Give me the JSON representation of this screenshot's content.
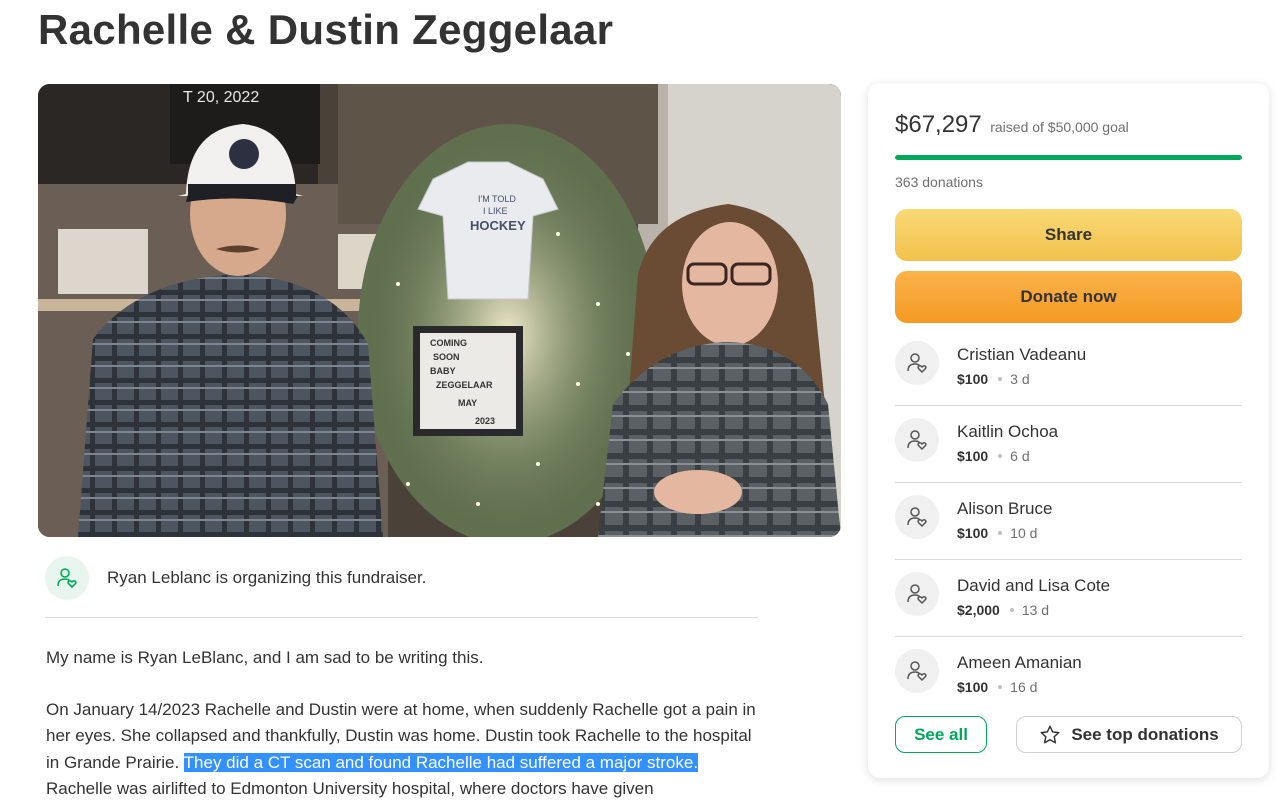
{
  "campaign": {
    "title": "Rachelle & Dustin Zeggelaar",
    "photo": {
      "sign_lines": [
        "COMING",
        "SOON",
        "BABY",
        "ZEGGELAAR",
        "MAY",
        "2023"
      ],
      "onesie_text": [
        "I'M TOLD",
        "I LIKE",
        "HOCKEY"
      ],
      "frame_text": "T 20, 2022"
    }
  },
  "organizer": {
    "text": "Ryan Leblanc is organizing this fundraiser.",
    "icon": "person-heart-icon"
  },
  "story": {
    "p1": "My name is Ryan LeBlanc, and I am sad to be writing this.",
    "p2_before": "On January 14/2023 Rachelle and Dustin were at home, when suddenly Rachelle got a pain in her eyes. She collapsed and thankfully, Dustin was home. Dustin took Rachelle to the hospital in Grande Prairie. ",
    "p2_highlight": "They did a CT scan and found Rachelle had suffered a major stroke.",
    "p2_after": " Rachelle was airlifted to Edmonton University hospital, where doctors have given"
  },
  "donation_card": {
    "amount_raised": "$67,297",
    "goal_text": "raised of $50,000 goal",
    "progress_fraction": 1.0,
    "donation_count": "363 donations",
    "share_label": "Share",
    "donate_label": "Donate now",
    "donors": [
      {
        "name": "Cristian Vadeanu",
        "amount": "$100",
        "time": "3 d"
      },
      {
        "name": "Kaitlin Ochoa",
        "amount": "$100",
        "time": "6 d"
      },
      {
        "name": "Alison Bruce",
        "amount": "$100",
        "time": "10 d"
      },
      {
        "name": "David and Lisa Cote",
        "amount": "$2,000",
        "time": "13 d"
      },
      {
        "name": "Ameen Amanian",
        "amount": "$100",
        "time": "16 d"
      }
    ],
    "see_all_label": "See all",
    "see_top_label": "See top donations"
  },
  "colors": {
    "accent_green": "#02a95c",
    "share_yellow": "#f2c14a",
    "donate_orange": "#f49a24",
    "highlight_blue": "#3390ff"
  }
}
